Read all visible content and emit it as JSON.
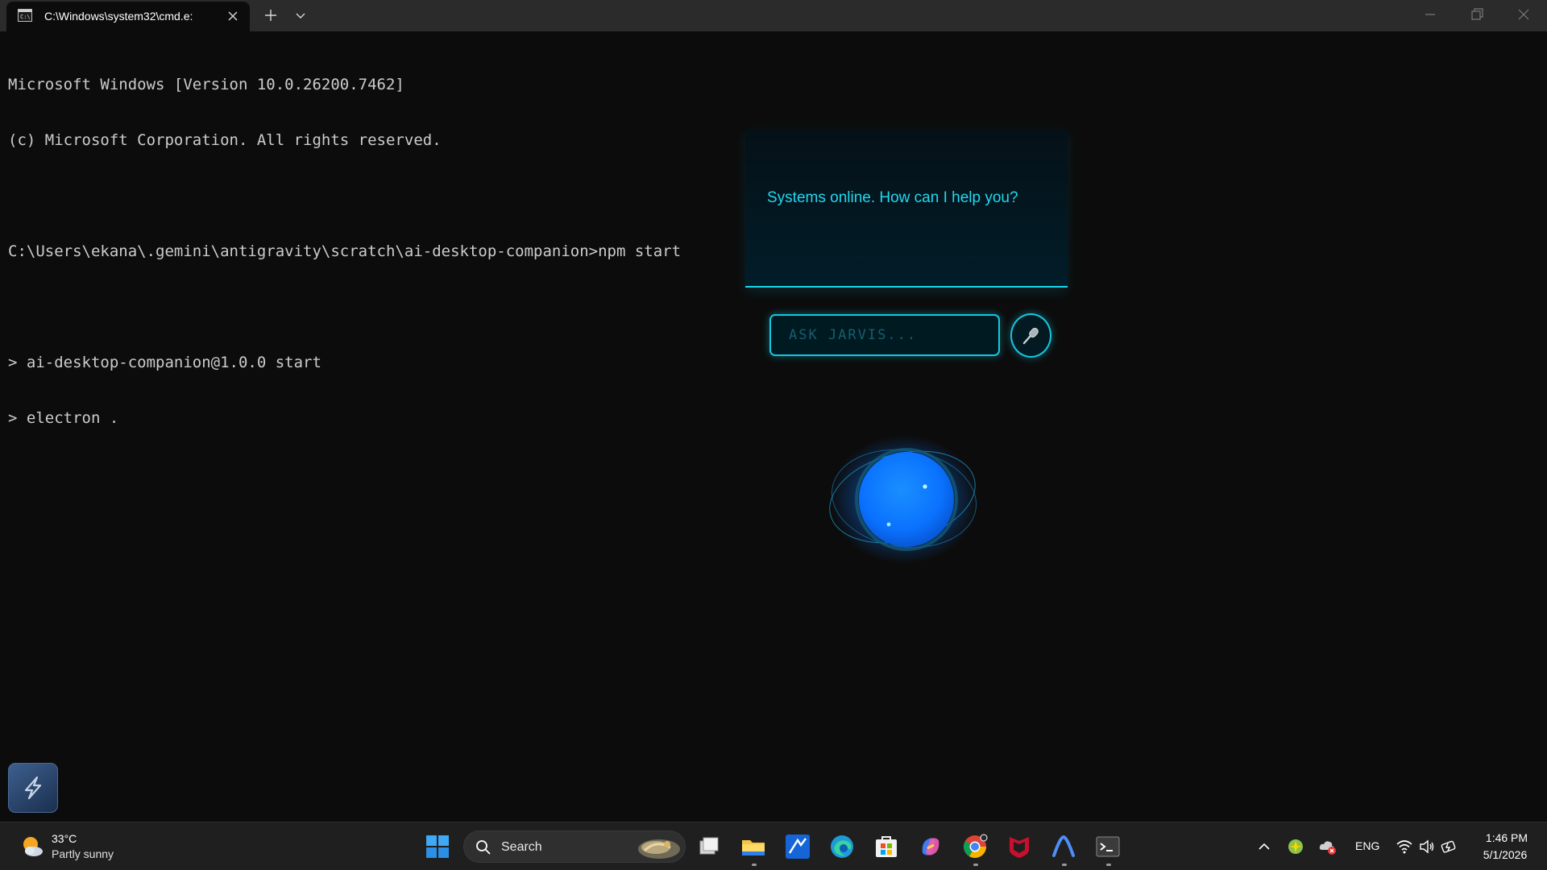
{
  "window": {
    "tab_title": "C:\\Windows\\system32\\cmd.e:",
    "new_tab_glyph": "+",
    "icons": [
      "terminal-icon",
      "close-icon",
      "plus-icon",
      "chevron-down-icon",
      "minimize-icon",
      "maximize-icon",
      "close-window-icon"
    ]
  },
  "terminal": {
    "lines": [
      "Microsoft Windows [Version 10.0.26200.7462]",
      "(c) Microsoft Corporation. All rights reserved.",
      "",
      "C:\\Users\\ekana\\.gemini\\antigravity\\scratch\\ai-desktop-companion>npm start",
      "",
      "> ai-desktop-companion@1.0.0 start",
      "> electron ."
    ]
  },
  "companion": {
    "message": "Systems online. How can I help you?",
    "input_placeholder": "ASK JARVIS...",
    "input_value": "",
    "mic_icon": "microphone-icon",
    "accent_color": "#19d7ee",
    "orb_color": "#0a7bff"
  },
  "taskbar": {
    "weather": {
      "temp": "33°C",
      "condition": "Partly sunny",
      "icon": "partly-sunny-icon"
    },
    "search_label": "Search",
    "pinned_apps": [
      "task-view-icon",
      "file-explorer-icon",
      "sketch-app-icon",
      "edge-icon",
      "microsoft-store-icon",
      "copilot-icon",
      "chrome-icon",
      "mcafee-icon",
      "antigravity-icon",
      "terminal-icon"
    ],
    "tray": {
      "language": "ENG",
      "time": "1:46 PM",
      "date": "5/1/2026",
      "icons": [
        "chevron-up-icon",
        "app-tray-icon",
        "cloud-error-icon",
        "wifi-icon",
        "volume-icon",
        "battery-icon"
      ]
    }
  }
}
